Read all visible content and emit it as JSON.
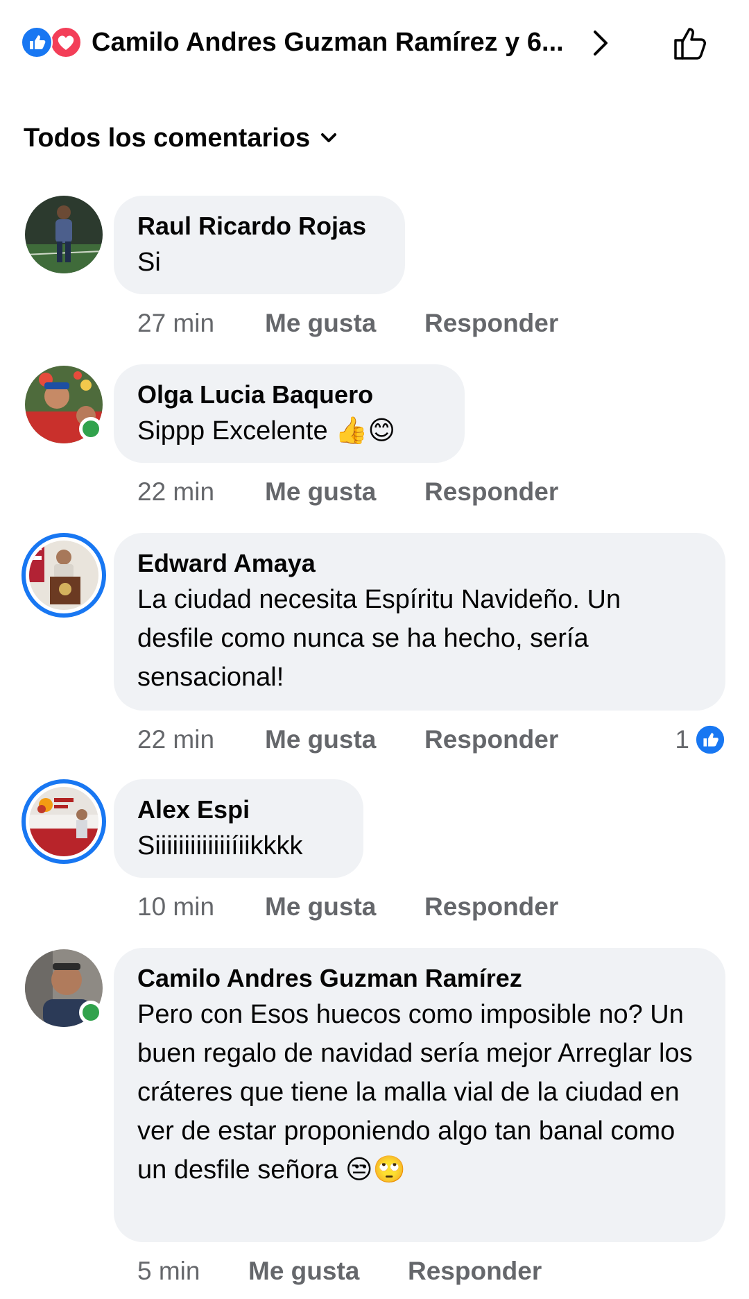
{
  "header": {
    "reactors_text": "Camilo Andres Guzman Ramírez y 6...",
    "reaction_icons": [
      "like-icon",
      "love-icon"
    ],
    "colors": {
      "like": "#1877f2",
      "love": "#f33e58"
    }
  },
  "filter": {
    "label": "Todos los comentarios"
  },
  "actions": {
    "like": "Me gusta",
    "reply": "Responder"
  },
  "comments": [
    {
      "author": "Raul Ricardo Rojas",
      "text": "Si",
      "time": "27 min",
      "online": false,
      "story_ring": false
    },
    {
      "author": "Olga Lucia Baquero",
      "text": "Sippp Excelente 👍😊",
      "time": "22 min",
      "online": true,
      "story_ring": false
    },
    {
      "author": "Edward Amaya",
      "text": "La ciudad necesita Espíritu Navideño. Un desfile como nunca se ha hecho, sería sensacional!",
      "time": "22 min",
      "online": false,
      "story_ring": true,
      "reactions": "1"
    },
    {
      "author": "Alex Espi",
      "text": "Siiiiiiiiiiiiiíiikkkk",
      "time": "10 min",
      "online": false,
      "story_ring": true
    },
    {
      "author": "Camilo Andres Guzman Ramírez",
      "text": "Pero con Esos huecos como imposible no? Un buen regalo de navidad sería mejor Arreglar los cráteres que tiene la malla vial de la ciudad en ver de estar proponiendo algo tan banal como un desfile señora 😒🙄",
      "time": "5 min",
      "online": true,
      "story_ring": false
    }
  ]
}
